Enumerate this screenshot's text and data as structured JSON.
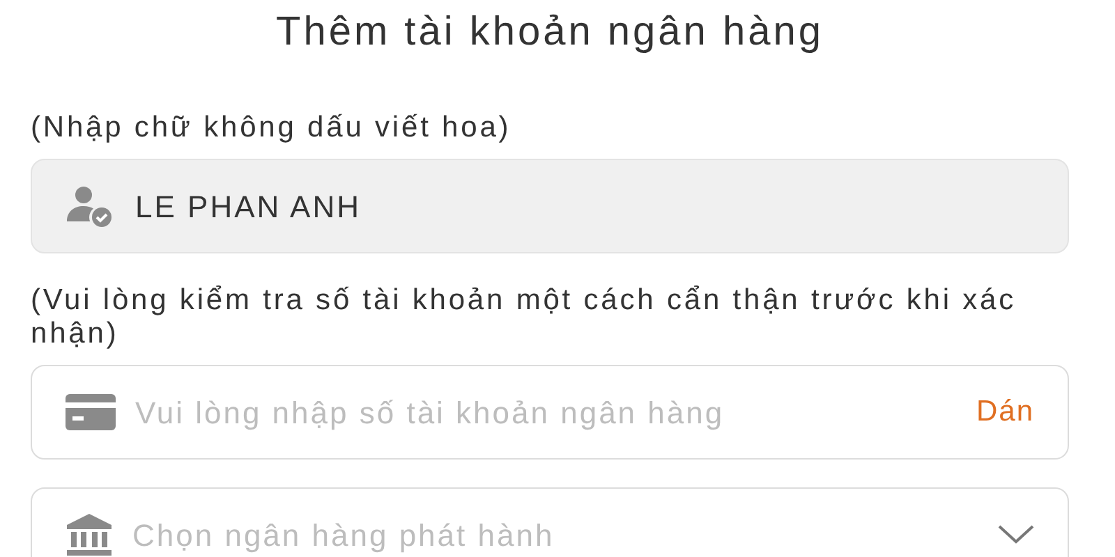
{
  "header": {
    "title": "Thêm tài khoản ngân hàng"
  },
  "fields": [
    {
      "kind": "name",
      "hint": "(Nhập chữ không dấu viết hoa)",
      "value": "LE PHAN ANH",
      "disabled": true
    },
    {
      "kind": "account",
      "hint": "(Vui lòng kiểm tra số tài khoản một cách cẩn thận trước khi xác nhận)",
      "placeholder": "Vui lòng nhập số tài khoản ngân hàng",
      "action": "Dán",
      "disabled": false
    },
    {
      "kind": "bank",
      "placeholder": "Chọn ngân hàng phát hành",
      "disabled": false
    }
  ]
}
